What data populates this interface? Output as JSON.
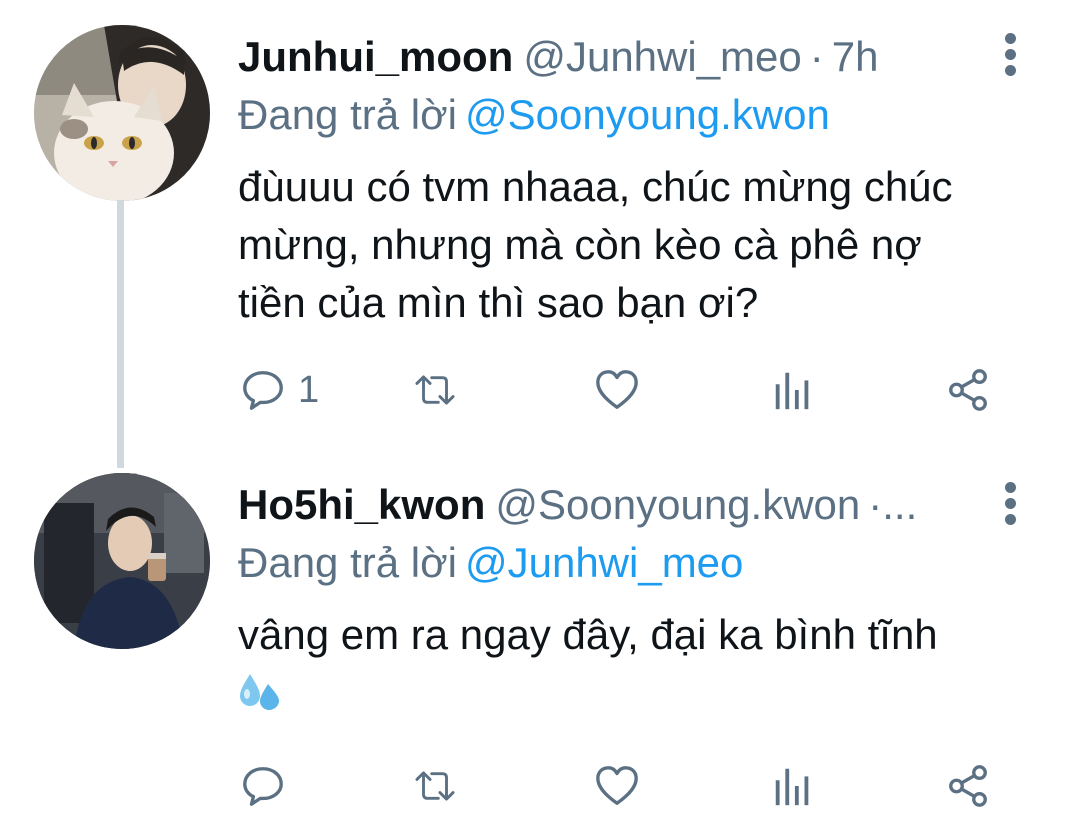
{
  "tweets": [
    {
      "display_name": "Junhui_moon",
      "handle": "@Junhwi_meo",
      "separator": "·",
      "time": "7h",
      "replying_prefix": "Đang trả lời",
      "replying_to": "@Soonyoung.kwon",
      "text": "đùuuu có tvm nhaaa, chúc mừng chúc mừng, nhưng mà còn kèo cà phê nợ tiền của mìn thì sao bạn ơi?",
      "reply_count": "1",
      "avatar": "avatar-photo-with-cat"
    },
    {
      "display_name": "Ho5hi_kwon",
      "handle": "@Soonyoung.kwon",
      "separator": "·...",
      "time": "",
      "replying_prefix": "Đang trả lời",
      "replying_to": "@Junhwi_meo",
      "text": "vâng em ra ngay đây, đại ka bình tĩnh",
      "emoji": "sweat-droplets-icon",
      "reply_count": "",
      "avatar": "avatar-photo-man-drinking"
    }
  ],
  "icons": {
    "reply": "reply-icon",
    "retweet": "retweet-icon",
    "like": "heart-icon",
    "stats": "stats-icon",
    "share": "share-icon",
    "more": "more-vertical-icon"
  },
  "colors": {
    "text": "#0f1419",
    "muted": "#5b7083",
    "link": "#1d9bf0",
    "thread_line": "#cfd9de"
  }
}
